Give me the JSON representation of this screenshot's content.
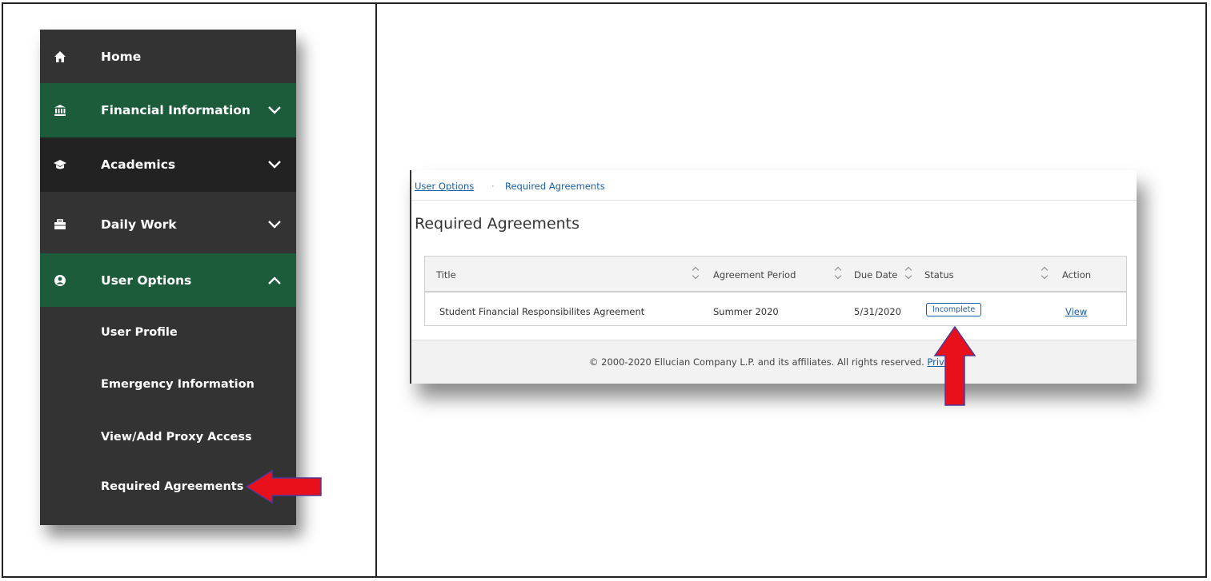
{
  "nav": {
    "items": [
      {
        "label": "Home",
        "icon": "home-icon"
      },
      {
        "label": "Financial Information",
        "icon": "bank-icon"
      },
      {
        "label": "Academics",
        "icon": "graduation-cap-icon"
      },
      {
        "label": "Daily Work",
        "icon": "briefcase-icon"
      },
      {
        "label": "User Options",
        "icon": "user-circle-icon"
      }
    ],
    "sub_items": [
      {
        "label": "User Profile"
      },
      {
        "label": "Emergency Information"
      },
      {
        "label": "View/Add Proxy Access"
      },
      {
        "label": "Required Agreements"
      }
    ]
  },
  "screenshot": {
    "breadcrumb": {
      "link": "User Options",
      "separator": "·",
      "current": "Required Agreements"
    },
    "page_title": "Required Agreements",
    "table": {
      "headers": [
        "Title",
        "Agreement Period",
        "Due Date",
        "Status",
        "Action"
      ],
      "rows": [
        {
          "title": "Student Financial Responsibilites Agreement",
          "period": "Summer 2020",
          "due": "5/31/2020",
          "status": "Incomplete",
          "action": "View"
        }
      ]
    },
    "footer": {
      "text": "© 2000-2020 Ellucian Company L.P. and its affiliates. All rights reserved.",
      "link": "Priva"
    }
  },
  "colors": {
    "nav_bg": "#333333",
    "nav_green": "#1d5c3a",
    "nav_dark": "#222222",
    "link": "#1a5ea8",
    "arrow": "#e8101a"
  }
}
